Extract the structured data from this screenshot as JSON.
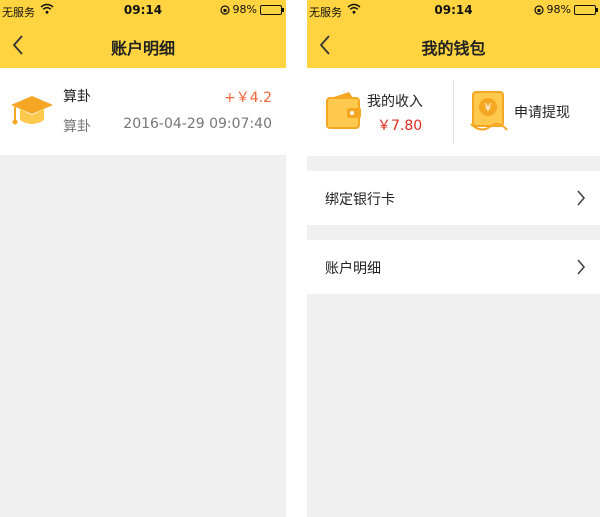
{
  "status_bar": {
    "carrier": "无服务",
    "time": "09:14",
    "battery": "98%",
    "battery_level": 0.98
  },
  "left_screen": {
    "nav_title": "账户明细",
    "transaction": {
      "title": "算卦",
      "subtitle": "算卦",
      "amount": "+￥4.2",
      "datetime": "2016-04-29 09:07:40",
      "icon": "graduation-cap-icon"
    }
  },
  "right_screen": {
    "nav_title": "我的钱包",
    "income": {
      "label": "我的收入",
      "value": "￥7.80",
      "icon": "wallet-icon"
    },
    "withdraw": {
      "label": "申请提现",
      "icon": "yuan-note-icon"
    },
    "menu": [
      {
        "label": "绑定银行卡"
      },
      {
        "label": "账户明细"
      }
    ]
  },
  "colors": {
    "accent": "#ffd440",
    "amount_positive": "#f0663a",
    "income_red": "#e02a1e",
    "icon_orange": "#f5a623"
  }
}
